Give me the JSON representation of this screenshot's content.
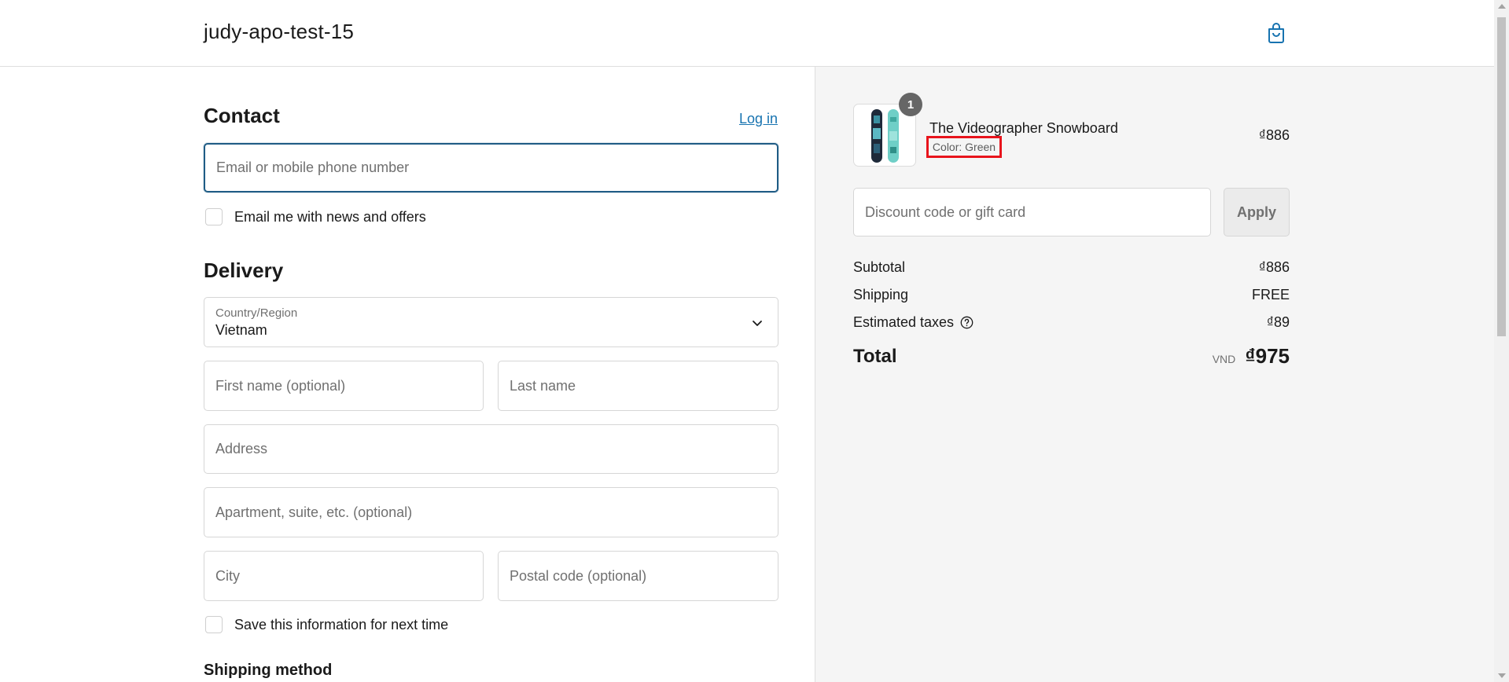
{
  "header": {
    "shop_name": "judy-apo-test-15",
    "cart_icon": "shopping-bag-icon"
  },
  "contact": {
    "title": "Contact",
    "login_label": "Log in",
    "email_placeholder": "Email or mobile phone number",
    "newsletter_label": "Email me with news and offers"
  },
  "delivery": {
    "title": "Delivery",
    "country_caption": "Country/Region",
    "country_value": "Vietnam",
    "first_name_placeholder": "First name (optional)",
    "last_name_placeholder": "Last name",
    "address_placeholder": "Address",
    "apartment_placeholder": "Apartment, suite, etc. (optional)",
    "city_placeholder": "City",
    "postal_placeholder": "Postal code (optional)",
    "save_info_label": "Save this information for next time",
    "shipping_method_title": "Shipping method"
  },
  "summary": {
    "item": {
      "name": "The Videographer Snowboard",
      "variant": "Color: Green",
      "price": "₫886",
      "quantity": "1"
    },
    "discount_placeholder": "Discount code or gift card",
    "apply_label": "Apply",
    "subtotal_label": "Subtotal",
    "subtotal_value": "₫886",
    "shipping_label": "Shipping",
    "shipping_value": "FREE",
    "taxes_label": "Estimated taxes",
    "taxes_value": "₫89",
    "total_label": "Total",
    "currency": "VND",
    "total_value": "₫975"
  },
  "colors": {
    "accent_link": "#1773b0",
    "focus_border": "#1f5c85",
    "highlight_box": "#e8141c",
    "summary_bg": "#f5f5f5"
  }
}
